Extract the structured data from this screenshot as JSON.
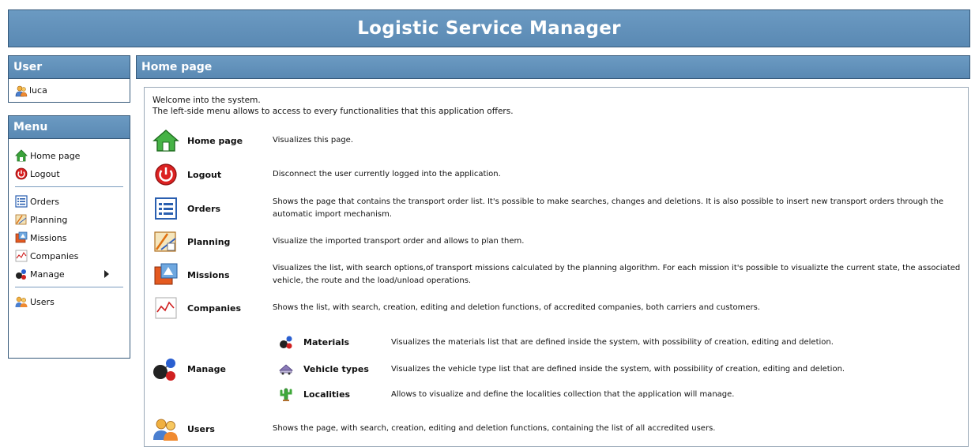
{
  "app": {
    "title": "Logistic Service Manager"
  },
  "user_panel": {
    "title": "User",
    "username": "luca"
  },
  "menu": {
    "title": "Menu",
    "items": [
      {
        "label": "Home page",
        "icon": "home-icon"
      },
      {
        "label": "Logout",
        "icon": "power-icon"
      },
      {
        "label": "Orders",
        "icon": "list-icon"
      },
      {
        "label": "Planning",
        "icon": "planning-icon"
      },
      {
        "label": "Missions",
        "icon": "missions-icon"
      },
      {
        "label": "Companies",
        "icon": "chart-icon"
      },
      {
        "label": "Manage",
        "icon": "molecule-icon"
      },
      {
        "label": "Users",
        "icon": "users-icon"
      }
    ]
  },
  "main": {
    "title": "Home page",
    "welcome_line1": "Welcome into the system.",
    "welcome_line2": "The left-side menu allows to access to every functionalities that this application offers.",
    "rows": [
      {
        "label": "Home page",
        "desc": "Visualizes this page."
      },
      {
        "label": "Logout",
        "desc": "Disconnect the user currently logged into the application."
      },
      {
        "label": "Orders",
        "desc": "Shows the page that contains the transport order list. It's possible to make searches, changes and deletions. It is also possible to insert new transport orders through the automatic import mechanism."
      },
      {
        "label": "Planning",
        "desc": "Visualize the imported transport order and allows to plan them."
      },
      {
        "label": "Missions",
        "desc": "Visualizes the list, with search options,of transport missions calculated by the planning algorithm. For each mission it's possible to visualizte the current state, the associated vehicle, the route and the load/unload operations."
      },
      {
        "label": "Companies",
        "desc": "Shows the list, with search, creation, editing and deletion functions, of accredited companies, both carriers and customers."
      },
      {
        "label": "Manage",
        "desc": ""
      },
      {
        "label": "Users",
        "desc": "Shows the page, with search, creation, editing and deletion functions, containing the list of all accredited users."
      }
    ],
    "manage_sub": [
      {
        "label": "Materials",
        "desc": "Visualizes the materials list that are defined inside the system, with possibility of creation, editing and deletion."
      },
      {
        "label": "Vehicle types",
        "desc": "Visualizes the vehicle type list that are defined inside the system, with possibility of creation, editing and deletion."
      },
      {
        "label": "Localities",
        "desc": "Allows to visualize and define the localities collection that the application will manage."
      }
    ]
  },
  "colors": {
    "header": "#5f8fb9",
    "border": "#36597a"
  }
}
